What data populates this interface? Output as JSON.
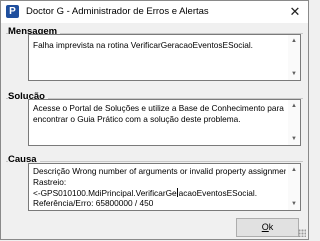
{
  "window": {
    "title": "Doctor G - Administrador de Erros e Alertas",
    "icon": "app-logo-icon",
    "icon_letter": "P",
    "close_glyph": "✕"
  },
  "sections": {
    "mensagem": {
      "label": "Mensagem",
      "text": "Falha imprevista na rotina VerificarGeracaoEventosESocial."
    },
    "solucao": {
      "label": "Solução",
      "text": "Acesse o Portal de Soluções e utilize a Base de Conhecimento para encontrar o Guia Prático com a solução deste problema."
    },
    "causa": {
      "label": "Causa",
      "line1": "Descrição Wrong number of arguments or invalid property assignment",
      "line2": "Rastreio:",
      "line3a": "<-GPS010100.MdiPrincipal.VerificarGe",
      "line3b": "acaoEventosESocial.",
      "line4": "Referência/Erro: 65800000 / 450"
    }
  },
  "buttons": {
    "ok_mnemonic": "O",
    "ok_rest": "k"
  }
}
